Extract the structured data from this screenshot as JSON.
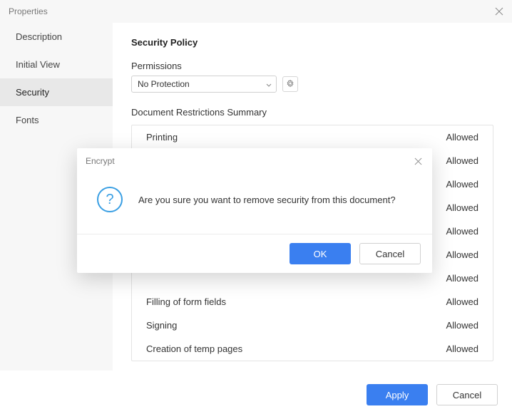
{
  "titlebar": {
    "title": "Properties"
  },
  "sidebar": {
    "tabs": [
      {
        "label": "Description"
      },
      {
        "label": "Initial View"
      },
      {
        "label": "Security"
      },
      {
        "label": "Fonts"
      }
    ]
  },
  "panel": {
    "title": "Security Policy",
    "permissions_label": "Permissions",
    "permissions_value": "No Protection",
    "summary_label": "Document Restrictions Summary",
    "restrictions": [
      {
        "name": "Printing",
        "value": "Allowed"
      },
      {
        "name": "",
        "value": "Allowed"
      },
      {
        "name": "",
        "value": "Allowed"
      },
      {
        "name": "",
        "value": "Allowed"
      },
      {
        "name": "",
        "value": "Allowed"
      },
      {
        "name": "",
        "value": "Allowed"
      },
      {
        "name": "",
        "value": "Allowed"
      },
      {
        "name": "Filling of form fields",
        "value": "Allowed"
      },
      {
        "name": "Signing",
        "value": "Allowed"
      },
      {
        "name": "Creation of temp pages",
        "value": "Allowed"
      }
    ]
  },
  "footer": {
    "apply_label": "Apply",
    "cancel_label": "Cancel"
  },
  "modal": {
    "title": "Encrypt",
    "message": "Are you sure you want to remove security from this document?",
    "ok_label": "OK",
    "cancel_label": "Cancel"
  }
}
